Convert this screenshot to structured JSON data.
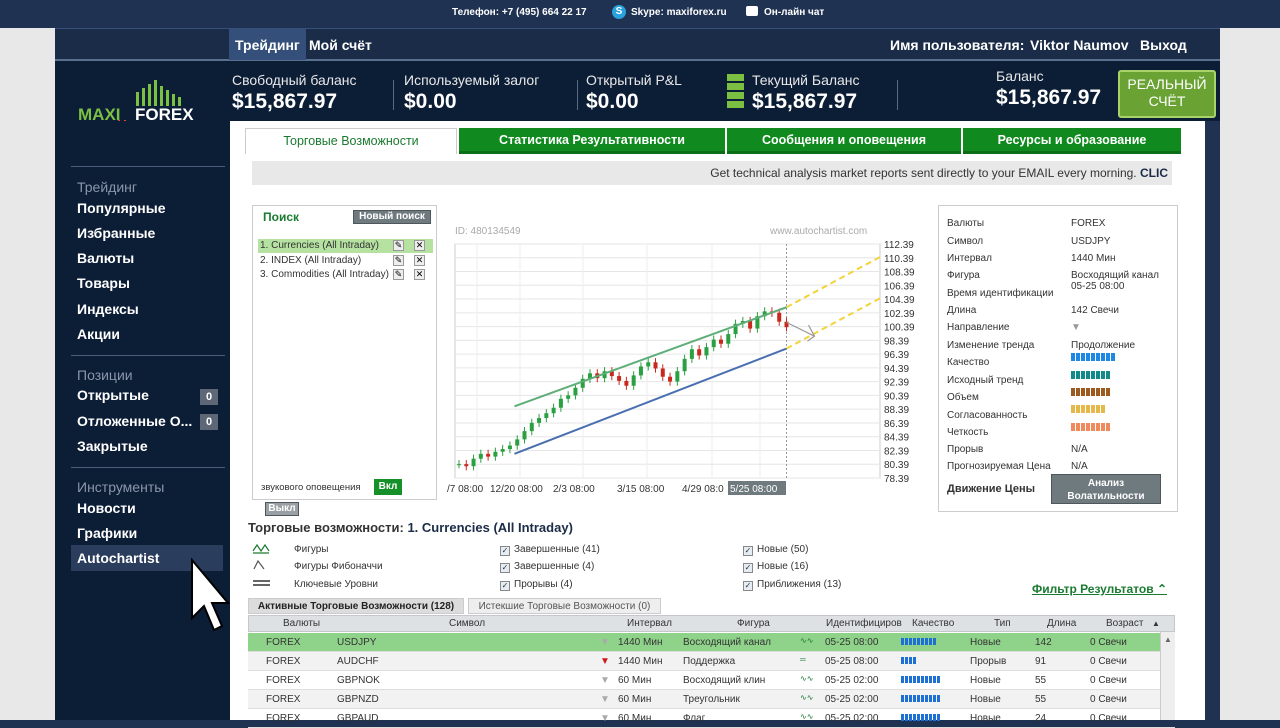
{
  "topbar": {
    "phone": "Телефон: +7 (495) 664 22 17",
    "skype": "Skype: maxiforex.ru",
    "chat": "Он-лайн чат"
  },
  "nav": {
    "trading": "Трейдинг",
    "account": "Мой счёт",
    "user_label": "Имя пользователя:",
    "user_name": "Viktor Naumov",
    "logout": "Выход"
  },
  "logo": {
    "maxi": "MAXI",
    "forex": "FOREX"
  },
  "balances": [
    {
      "label": "Свободный баланс",
      "value": "$15,867.97"
    },
    {
      "label": "Используемый залог",
      "value": "$0.00"
    },
    {
      "label": "Открытый P&L",
      "value": "$0.00"
    },
    {
      "label": "Текущий Баланс",
      "value": "$15,867.97"
    },
    {
      "label": "Баланс",
      "value": "$15,867.97"
    }
  ],
  "real_account": {
    "line1": "РЕАЛЬНЫЙ",
    "line2": "СЧЁТ"
  },
  "sidebar": {
    "trading_header": "Трейдинг",
    "trading": [
      "Популярные",
      "Избранные",
      "Валюты",
      "Товары",
      "Индексы",
      "Акции"
    ],
    "positions_header": "Позиции",
    "positions": [
      {
        "label": "Открытые",
        "count": "0"
      },
      {
        "label": "Отложенные О...",
        "count": "0"
      },
      {
        "label": "Закрытые"
      }
    ],
    "tools_header": "Инструменты",
    "tools": [
      "Новости",
      "Графики",
      "Autochartist"
    ]
  },
  "tabs": [
    "Торговые Возможности",
    "Статистика Результативности",
    "Сообщения и оповещения",
    "Ресурсы и образование"
  ],
  "banner": {
    "text": "Get technical analysis market reports sent directly to your EMAIL every morning.",
    "link": "CLIC"
  },
  "search": {
    "title": "Поиск",
    "new_search": "Новый поиск",
    "items": [
      "1. Currencies (All Intraday)",
      "2. INDEX (All Intraday)",
      "3. Commodities (All Intraday)"
    ],
    "sound": "звукового оповещения",
    "on": "Вкл",
    "off": "Выкл"
  },
  "chart_data": {
    "type": "line",
    "id": "ID: 480134549",
    "watermark": "www.autochartist.com",
    "x_labels": [
      "/7 08:00",
      "12/20 08:00",
      "2/3 08:00",
      "3/15 08:00",
      "4/29 08:0",
      "5/25 08:00"
    ],
    "y_ticks": [
      "112.39",
      "110.39",
      "108.39",
      "106.39",
      "104.39",
      "102.39",
      "100.39",
      "98.39",
      "96.39",
      "94.39",
      "92.39",
      "90.39",
      "88.39",
      "86.39",
      "84.39",
      "82.39",
      "80.39",
      "78.39"
    ],
    "ylim": [
      78.39,
      112.39
    ],
    "close": [
      80.4,
      80.1,
      81.2,
      81.9,
      81.5,
      82.2,
      82.6,
      83.1,
      84.0,
      85.2,
      86.4,
      87.1,
      87.8,
      88.6,
      89.9,
      90.4,
      91.5,
      92.8,
      93.6,
      92.9,
      93.9,
      93.2,
      92.5,
      91.8,
      93.3,
      94.6,
      95.2,
      94.3,
      93.1,
      92.4,
      93.9,
      95.7,
      97.1,
      96.2,
      97.4,
      98.5,
      97.9,
      99.3,
      100.8,
      101.2,
      100.1,
      101.9,
      102.6,
      102.4,
      101.1,
      100.3
    ],
    "channel_upper": [
      [
        0.14,
        88.8
      ],
      [
        0.78,
        103.2
      ]
    ],
    "channel_lower": [
      [
        0.14,
        81.9
      ],
      [
        0.78,
        97.2
      ]
    ],
    "projection_upper": [
      [
        0.78,
        103.2
      ],
      [
        1.0,
        110.5
      ]
    ],
    "projection_lower": [
      [
        0.78,
        97.2
      ],
      [
        1.0,
        104.5
      ]
    ]
  },
  "info": {
    "rows": [
      {
        "k": "Валюты",
        "v": "FOREX"
      },
      {
        "k": "Символ",
        "v": "USDJPY"
      },
      {
        "k": "Интервал",
        "v": "1440 Мин"
      },
      {
        "k": "Фигура",
        "v": "Восходящий канал 05-25 08:00"
      },
      {
        "k": "Время идентификации",
        "v": ""
      },
      {
        "k": "Длина",
        "v": "142 Свечи"
      },
      {
        "k": "Направление",
        "v": "▼"
      },
      {
        "k": "Изменение тренда",
        "v": "Продолжение"
      },
      {
        "k": "Качество",
        "v": ""
      },
      {
        "k": "Исходный тренд",
        "v": ""
      },
      {
        "k": "Объем",
        "v": ""
      },
      {
        "k": "Согласованность",
        "v": ""
      },
      {
        "k": "Четкость",
        "v": ""
      },
      {
        "k": "Прорыв",
        "v": "N/A"
      },
      {
        "k": "Прогнозируемая Цена",
        "v": "N/A"
      }
    ],
    "quality_bars": [
      {
        "count": 9,
        "color": "#1e88e5"
      },
      {
        "count": 8,
        "color": "#138a8a"
      },
      {
        "count": 8,
        "color": "#9c5a1e"
      },
      {
        "count": 7,
        "color": "#e6b84a"
      },
      {
        "count": 8,
        "color": "#f08a5d"
      }
    ],
    "price_move": "Движение Цены",
    "volatility": "Анализ Волатильности"
  },
  "opps": {
    "title": "Торговые возможности:",
    "subset": "1. Currencies (All Intraday)"
  },
  "legend": {
    "patterns": "Фигуры",
    "fib": "Фигуры Фибоначчи",
    "levels": "Ключевые Уровни",
    "completed": "Завершенные (41)",
    "completed2": "Завершенные (4)",
    "breakouts": "Прорывы (4)",
    "new1": "Новые (50)",
    "new2": "Новые (16)",
    "approach": "Приближения (13)"
  },
  "filter": "Фильтр Результатов",
  "subtabs": {
    "active": "Активные Торговые Возможности (128)",
    "expired": "Истекшие Торговые Возможности (0)"
  },
  "table": {
    "headers": [
      "Валюты",
      "Символ",
      "Интервал",
      "Фигура",
      "Идентифициров",
      "Качество",
      "Тип",
      "Длина",
      "Возраст"
    ],
    "rows": [
      {
        "cur": "FOREX",
        "sym": "USDJPY",
        "dir": "▼",
        "int": "1440 Мин",
        "pat": "Восходящий канал",
        "time": "05-25 08:00",
        "q": 9,
        "type": "Новые",
        "len": "142",
        "age": "0 Свечи"
      },
      {
        "cur": "FOREX",
        "sym": "AUDCHF",
        "dir": "▼",
        "int": "1440 Мин",
        "pat": "Поддержка",
        "time": "05-25 08:00",
        "q": 4,
        "type": "Прорыв",
        "len": "91",
        "age": "0 Свечи"
      },
      {
        "cur": "FOREX",
        "sym": "GBPNOK",
        "dir": "▼",
        "int": "60 Мин",
        "pat": "Восходящий клин",
        "time": "05-25 02:00",
        "q": 10,
        "type": "Новые",
        "len": "55",
        "age": "0 Свечи"
      },
      {
        "cur": "FOREX",
        "sym": "GBPNZD",
        "dir": "▼",
        "int": "60 Мин",
        "pat": "Треугольник",
        "time": "05-25 02:00",
        "q": 10,
        "type": "Новые",
        "len": "55",
        "age": "0 Свечи"
      },
      {
        "cur": "FOREX",
        "sym": "GBPAUD",
        "dir": "▼",
        "int": "60 Мин",
        "pat": "Флаг",
        "time": "05-25 02:00",
        "q": 10,
        "type": "Новые",
        "len": "24",
        "age": "0 Свечи"
      }
    ]
  }
}
